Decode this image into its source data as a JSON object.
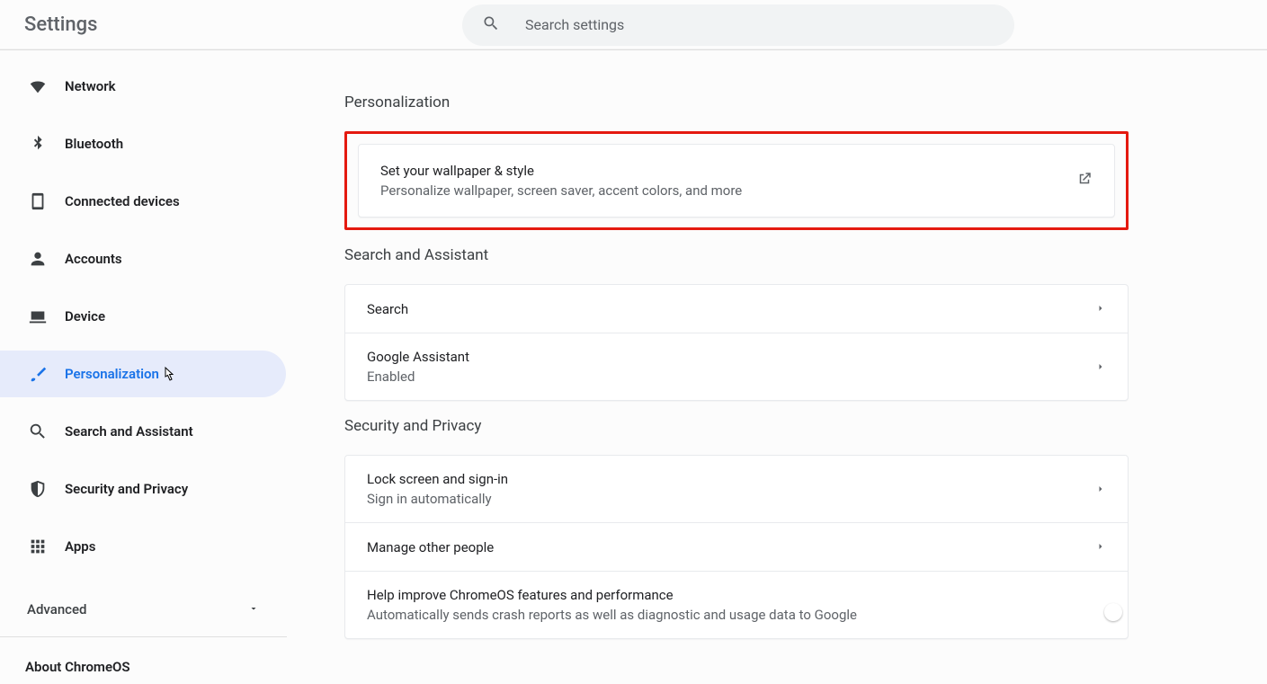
{
  "header": {
    "title": "Settings",
    "search_placeholder": "Search settings"
  },
  "sidebar": {
    "items": [
      {
        "id": "network",
        "label": "Network",
        "icon": "wifi"
      },
      {
        "id": "bluetooth",
        "label": "Bluetooth",
        "icon": "bluetooth"
      },
      {
        "id": "devices",
        "label": "Connected devices",
        "icon": "phone"
      },
      {
        "id": "accounts",
        "label": "Accounts",
        "icon": "person"
      },
      {
        "id": "device",
        "label": "Device",
        "icon": "laptop"
      },
      {
        "id": "personal",
        "label": "Personalization",
        "icon": "brush",
        "active": true
      },
      {
        "id": "search",
        "label": "Search and Assistant",
        "icon": "search"
      },
      {
        "id": "security",
        "label": "Security and Privacy",
        "icon": "shield"
      },
      {
        "id": "apps",
        "label": "Apps",
        "icon": "apps"
      }
    ],
    "advanced_label": "Advanced",
    "about_label": "About ChromeOS"
  },
  "main": {
    "sections": [
      {
        "title": "Personalization",
        "highlighted": true,
        "rows": [
          {
            "title": "Set your wallpaper & style",
            "subtitle": "Personalize wallpaper, screen saver, accent colors, and more",
            "trail": "external"
          }
        ]
      },
      {
        "title": "Search and Assistant",
        "rows": [
          {
            "title": "Search",
            "trail": "arrow"
          },
          {
            "title": "Google Assistant",
            "subtitle": "Enabled",
            "trail": "arrow"
          }
        ]
      },
      {
        "title": "Security and Privacy",
        "rows": [
          {
            "title": "Lock screen and sign-in",
            "subtitle": "Sign in automatically",
            "trail": "arrow"
          },
          {
            "title": "Manage other people",
            "trail": "arrow"
          },
          {
            "title": "Help improve ChromeOS features and performance",
            "subtitle": "Automatically sends crash reports as well as diagnostic and usage data to Google",
            "trail": "toggle",
            "toggle": false
          }
        ]
      }
    ]
  }
}
